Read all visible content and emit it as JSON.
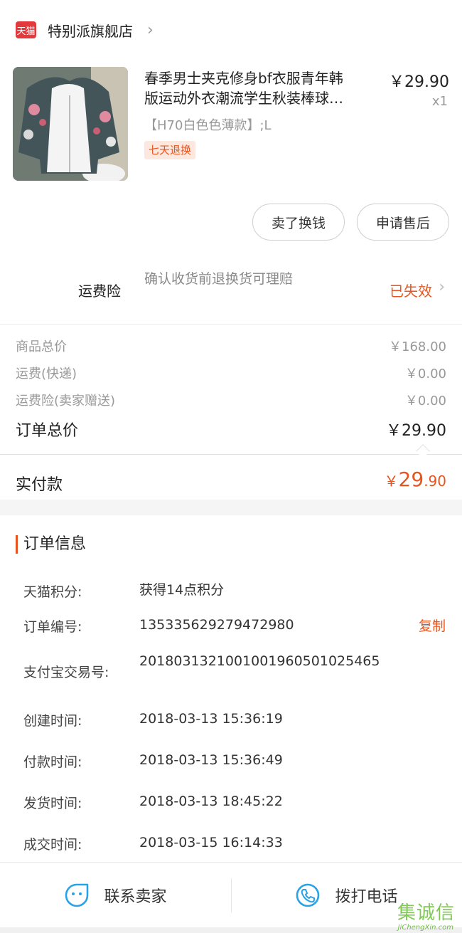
{
  "shop": {
    "badge": "天猫",
    "name": "特别派旗舰店",
    "chevron": "›"
  },
  "product": {
    "title_line1": "春季男士夹克修身bf衣服青年韩",
    "title_line2": "版运动外衣潮流学生秋装棒球…",
    "price": "￥29.90",
    "qty": "x1",
    "sku": "【H70白色色薄款】;L",
    "badge": "七天退换"
  },
  "actions": {
    "sell": "卖了换钱",
    "after_sale": "申请售后"
  },
  "insurance": {
    "label": "运费险",
    "desc": "确认收货前退换货可理赔",
    "status": "已失效",
    "chevron": "›"
  },
  "fees": {
    "goods_label": "商品总价",
    "goods_value": "￥168.00",
    "shipping_label": "运费(快递)",
    "shipping_value": "￥0.00",
    "ins_label": "运费险(卖家赠送)",
    "ins_value": "￥0.00",
    "total_label": "订单总价",
    "total_value": "￥29.90"
  },
  "paid": {
    "label": "实付款",
    "currency": "￥",
    "int": "29",
    "dec": ".90"
  },
  "info": {
    "title": "订单信息",
    "rows": [
      {
        "k": "天猫积分:",
        "v": "获得14点积分"
      },
      {
        "k": "订单编号:",
        "v": "135335629279472980"
      },
      {
        "k": "支付宝交易号:",
        "v": "2018031321001001960501025465"
      },
      {
        "k": "创建时间:",
        "v": "2018-03-13 15:36:19"
      },
      {
        "k": "付款时间:",
        "v": "2018-03-13 15:36:49"
      },
      {
        "k": "发货时间:",
        "v": "2018-03-13 18:45:22"
      },
      {
        "k": "成交时间:",
        "v": "2018-03-15 16:14:33"
      }
    ],
    "copy": "复制"
  },
  "bottom": {
    "contact": "联系卖家",
    "call": "拨打电话"
  },
  "watermark": {
    "main": "集诚信",
    "sub": "JiChengXin.com"
  },
  "colors": {
    "accent": "#e8541e",
    "tmall": "#e4393c",
    "icon_blue": "#2aa3e6"
  },
  "icons": [
    "tmall-logo-icon",
    "chevron-right-icon",
    "chat-face-icon",
    "phone-icon"
  ]
}
